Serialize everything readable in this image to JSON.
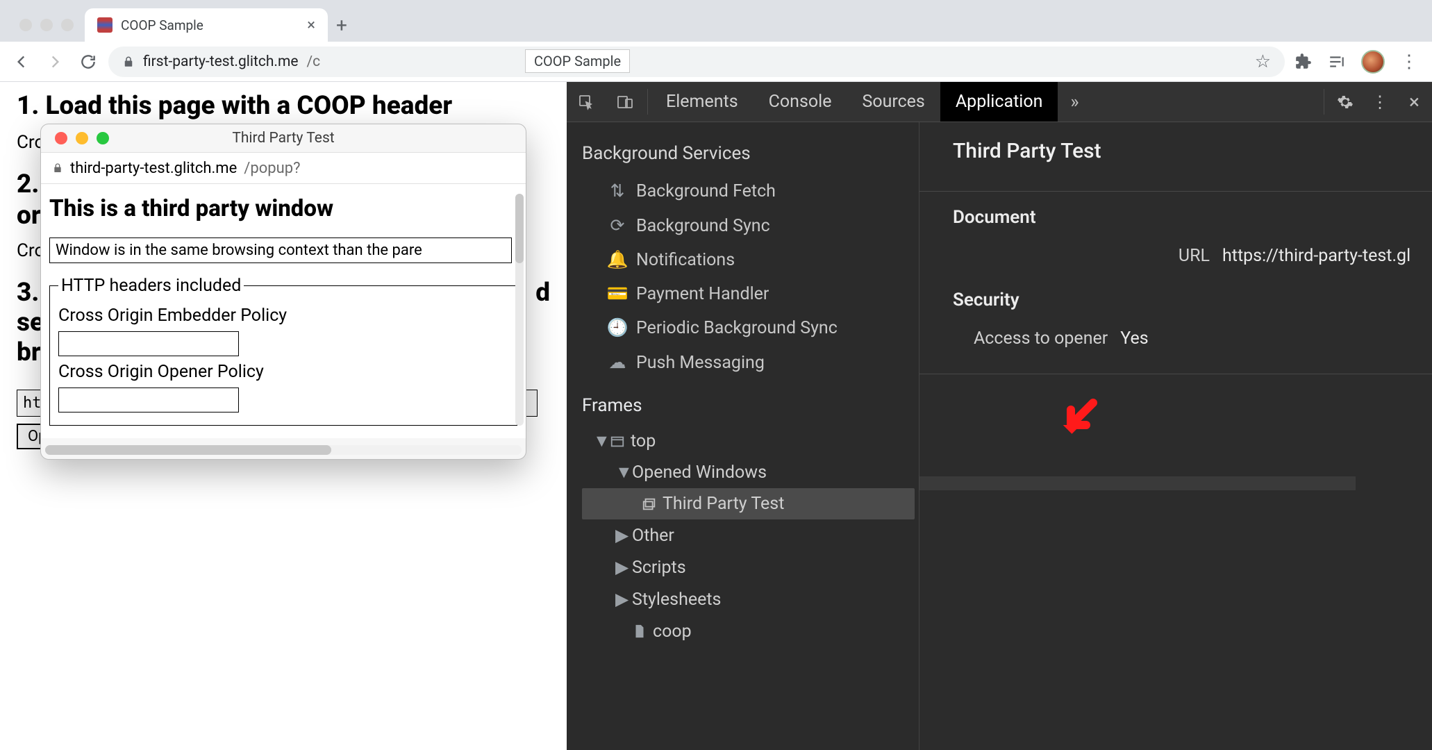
{
  "browser": {
    "tab_title": "COOP Sample",
    "url_host": "first-party-test.glitch.me",
    "url_path": "/c",
    "tooltip": "COOP Sample"
  },
  "page": {
    "h1": "1. Load this page with a COOP header",
    "cro_prefix": "Cro",
    "input1_value": "http",
    "h2": "2.",
    "or_line": "or",
    "cro_prefix2": "Cro",
    "h3_head": "3.",
    "h3_tail_d": "d",
    "se_line": "se",
    "br_line": "br",
    "url_value": "https://third-party-test.glitch.me/popup?",
    "open_btn": "Open a popup"
  },
  "popup": {
    "title": "Third Party Test",
    "url_host": "third-party-test.glitch.me",
    "url_path": "/popup?",
    "heading": "This is a third party window",
    "context_msg": "Window is in the same browsing context than the pare",
    "fieldset_legend": "HTTP headers included",
    "coep_label": "Cross Origin Embedder Policy",
    "coop_label": "Cross Origin Opener Policy"
  },
  "devtools": {
    "tabs": {
      "elements": "Elements",
      "console": "Console",
      "sources": "Sources",
      "application": "Application"
    },
    "bg_services_title": "Background Services",
    "bg_items": {
      "fetch": "Background Fetch",
      "sync": "Background Sync",
      "notif": "Notifications",
      "payment": "Payment Handler",
      "periodic": "Periodic Background Sync",
      "push": "Push Messaging"
    },
    "frames_title": "Frames",
    "tree": {
      "top": "top",
      "opened": "Opened Windows",
      "tpt": "Third Party Test",
      "other": "Other",
      "scripts": "Scripts",
      "styles": "Stylesheets",
      "coop": "coop"
    },
    "main": {
      "title": "Third Party Test",
      "doc_header": "Document",
      "url_label": "URL",
      "url_value": "https://third-party-test.gl",
      "sec_header": "Security",
      "access_label": "Access to opener",
      "access_value": "Yes"
    }
  }
}
